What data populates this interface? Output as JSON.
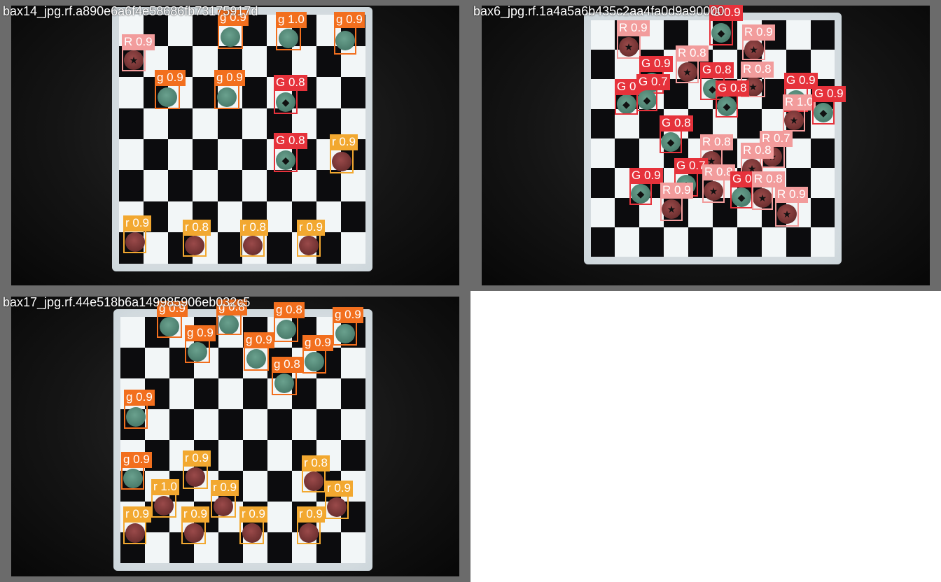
{
  "colors": {
    "g": "#f26f1e",
    "r": "#f2a830",
    "G": "#e6323b",
    "R": "#f29c9c"
  },
  "tiles": [
    {
      "filename": "bax14_jpg.rf.a890e6a6f4e58686fb73175917d",
      "detections": [
        {
          "cls": "R",
          "label": "R 0.9",
          "mark": "star"
        },
        {
          "cls": "g",
          "label": "g 0.9",
          "mark": ""
        },
        {
          "cls": "g",
          "label": "g 0.9",
          "mark": ""
        },
        {
          "cls": "g",
          "label": "g 1.0",
          "mark": ""
        },
        {
          "cls": "g",
          "label": "g 0.9",
          "mark": ""
        },
        {
          "cls": "g",
          "label": "g 0.9",
          "mark": ""
        },
        {
          "cls": "G",
          "label": "G 0.8",
          "mark": "diamond"
        },
        {
          "cls": "G",
          "label": "G 0.8",
          "mark": "diamond"
        },
        {
          "cls": "r",
          "label": "r 0.9",
          "mark": ""
        },
        {
          "cls": "r",
          "label": "r 0.9",
          "mark": ""
        },
        {
          "cls": "r",
          "label": "r 0.8",
          "mark": ""
        },
        {
          "cls": "r",
          "label": "r 0.8",
          "mark": ""
        },
        {
          "cls": "r",
          "label": "r 0.9",
          "mark": ""
        }
      ]
    },
    {
      "filename": "bax6_jpg.rf.1a4a5a6b435c2aa4fa0d9a90000",
      "detections": [
        {
          "cls": "R",
          "label": "R 0.9",
          "mark": "star"
        },
        {
          "cls": "G",
          "label": "G 0.9",
          "mark": "diamond"
        },
        {
          "cls": "R",
          "label": "R 0.9",
          "mark": "star"
        },
        {
          "cls": "G",
          "label": "G 0.9",
          "mark": "diamond"
        },
        {
          "cls": "R",
          "label": "R 0.8",
          "mark": "star"
        },
        {
          "cls": "G",
          "label": "G 0.8",
          "mark": "diamond"
        },
        {
          "cls": "R",
          "label": "R 0.8",
          "mark": "star"
        },
        {
          "cls": "G",
          "label": "G 0.3",
          "mark": "diamond"
        },
        {
          "cls": "G",
          "label": "G 0.7",
          "mark": "diamond"
        },
        {
          "cls": "G",
          "label": "G 0.8",
          "mark": "diamond"
        },
        {
          "cls": "G",
          "label": "G 0.9",
          "mark": "diamond"
        },
        {
          "cls": "R",
          "label": "R 1.0",
          "mark": "star"
        },
        {
          "cls": "G",
          "label": "G 0.9",
          "mark": "diamond"
        },
        {
          "cls": "G",
          "label": "G 0.8",
          "mark": "diamond"
        },
        {
          "cls": "R",
          "label": "R 0.8",
          "mark": "star"
        },
        {
          "cls": "R",
          "label": "R 0.7",
          "mark": "star"
        },
        {
          "cls": "R",
          "label": "R 0.8",
          "mark": "star"
        },
        {
          "cls": "G",
          "label": "G 0.7",
          "mark": "diamond"
        },
        {
          "cls": "G",
          "label": "G 0.9",
          "mark": "diamond"
        },
        {
          "cls": "R",
          "label": "R 0.9",
          "mark": "star"
        },
        {
          "cls": "R",
          "label": "R 0.8",
          "mark": "star"
        },
        {
          "cls": "G",
          "label": "G 0.7",
          "mark": "diamond"
        },
        {
          "cls": "R",
          "label": "R 0.8",
          "mark": "star"
        },
        {
          "cls": "R",
          "label": "R 0.9",
          "mark": "star"
        }
      ]
    },
    {
      "filename": "bax17_jpg.rf.44e518b6a149985906eb032c5",
      "detections": [
        {
          "cls": "g",
          "label": "g 0.9",
          "mark": ""
        },
        {
          "cls": "g",
          "label": "g 0.8",
          "mark": ""
        },
        {
          "cls": "g",
          "label": "g 0.9",
          "mark": ""
        },
        {
          "cls": "g",
          "label": "g 0.8",
          "mark": ""
        },
        {
          "cls": "g",
          "label": "g 0.9",
          "mark": ""
        },
        {
          "cls": "g",
          "label": "g 0.9",
          "mark": ""
        },
        {
          "cls": "g",
          "label": "g 0.9",
          "mark": ""
        },
        {
          "cls": "g",
          "label": "g 0.8",
          "mark": ""
        },
        {
          "cls": "g",
          "label": "g 0.9",
          "mark": ""
        },
        {
          "cls": "g",
          "label": "g 0.9",
          "mark": ""
        },
        {
          "cls": "r",
          "label": "r 0.9",
          "mark": ""
        },
        {
          "cls": "r",
          "label": "r 0.8",
          "mark": ""
        },
        {
          "cls": "r",
          "label": "r 1.0",
          "mark": ""
        },
        {
          "cls": "r",
          "label": "r 0.9",
          "mark": ""
        },
        {
          "cls": "r",
          "label": "r 0.9",
          "mark": ""
        },
        {
          "cls": "r",
          "label": "r 0.9",
          "mark": ""
        },
        {
          "cls": "r",
          "label": "r 0.9",
          "mark": ""
        },
        {
          "cls": "r",
          "label": "r 0.9",
          "mark": ""
        },
        {
          "cls": "r",
          "label": "r 0.9",
          "mark": ""
        }
      ]
    }
  ]
}
